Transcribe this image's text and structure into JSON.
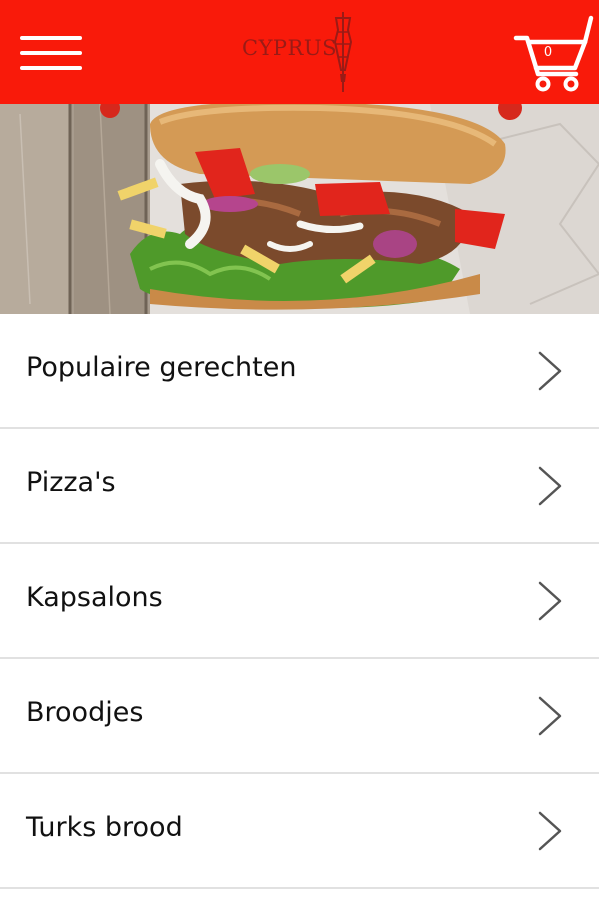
{
  "header": {
    "logo_text": "CYPRUS",
    "cart_count": "0",
    "brand_color": "#f91a0a",
    "menu_icon": "hamburger-menu-icon",
    "cart_icon": "shopping-cart-icon"
  },
  "hero": {
    "image": "doner-kebab-sandwich"
  },
  "categories": [
    {
      "label": "Populaire gerechten"
    },
    {
      "label": "Pizza's"
    },
    {
      "label": "Kapsalons"
    },
    {
      "label": "Broodjes"
    },
    {
      "label": "Turks brood"
    }
  ],
  "icons": {
    "list_arrow": "chevron-right-icon"
  }
}
